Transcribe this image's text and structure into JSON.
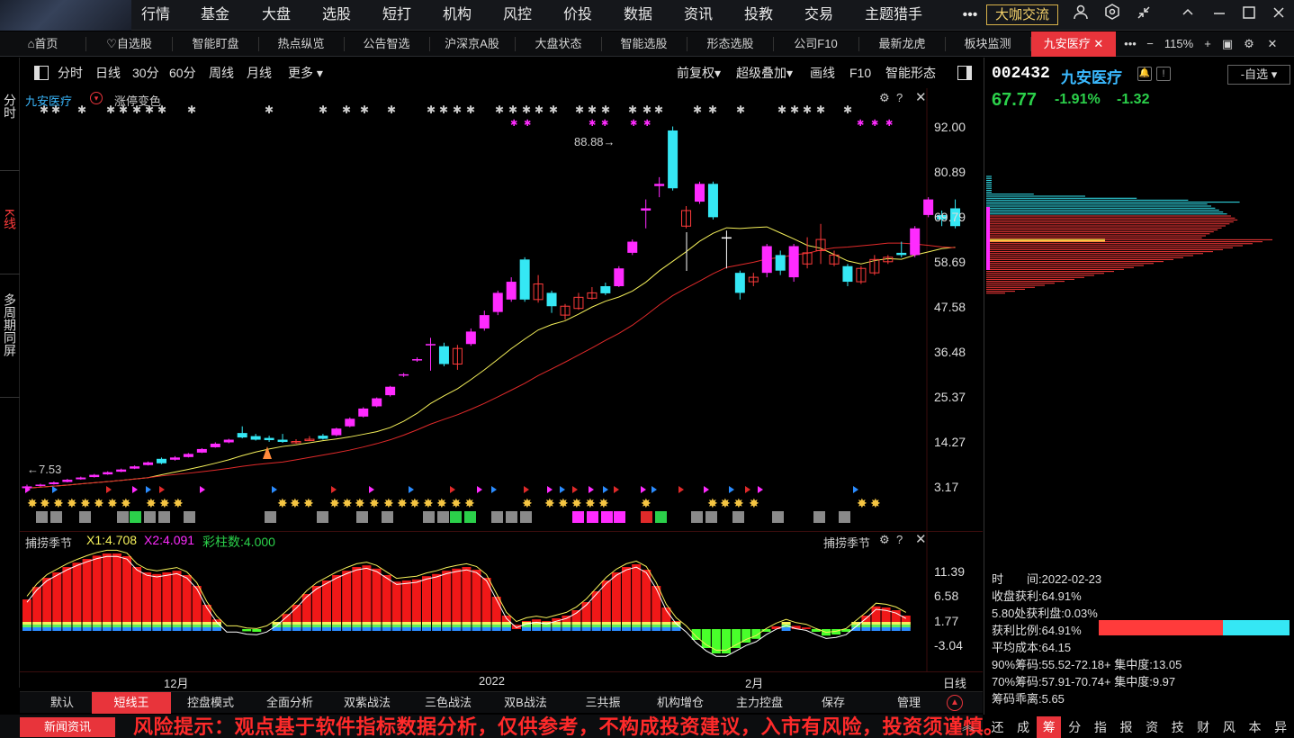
{
  "top_menu": {
    "items": [
      "行情",
      "基金",
      "大盘",
      "选股",
      "短打",
      "机构",
      "风控",
      "价投",
      "数据",
      "资讯",
      "投教",
      "交易",
      "主题猎手"
    ],
    "more": "•••",
    "cafe_button": "大咖交流"
  },
  "tab_bar": {
    "tabs": [
      "首页",
      "自选股",
      "智能盯盘",
      "热点纵览",
      "公告智选",
      "沪深京A股",
      "大盘状态",
      "智能选股",
      "形态选股",
      "公司F10",
      "最新龙虎",
      "板块监测",
      "九安医疗"
    ],
    "zoom": "115%"
  },
  "left_strip": {
    "labels": [
      "分时",
      "K线",
      "多周期同屏"
    ]
  },
  "period_bar": {
    "items": [
      "分时",
      "日线",
      "30分",
      "60分",
      "周线",
      "月线",
      "更多"
    ],
    "right_items": [
      "前复权",
      "超级叠加",
      "画线",
      "F10",
      "智能形态"
    ]
  },
  "main_chart": {
    "stock_label": "九安医疗",
    "indicator_label": "涨停变色",
    "high_annotation": "88.88",
    "low_annotation": "7.53",
    "price_ticks": [
      "92.00",
      "80.89",
      "69.79",
      "58.69",
      "47.58",
      "36.48",
      "25.37",
      "14.27",
      "3.17"
    ]
  },
  "sub_chart": {
    "name": "捕捞季节",
    "x1": "X1:4.708",
    "x2": "X2:4.091",
    "bars": "彩柱数:4.000",
    "ticks": [
      "11.39",
      "6.58",
      "1.77",
      "-3.04"
    ],
    "title_right": "捕捞季节"
  },
  "time_axis": {
    "labels": [
      "12月",
      "2022",
      "2月"
    ],
    "period": "日线"
  },
  "strategy_bar": {
    "items": [
      "默认",
      "短线王",
      "控盘模式",
      "全面分析",
      "双紫战法",
      "三色战法",
      "双B战法",
      "三共振",
      "机构增仓",
      "主力控盘",
      "保存",
      "管理"
    ]
  },
  "right_panel": {
    "code": "002432",
    "name": "九安医疗",
    "self_button": "-自选",
    "price": "67.77",
    "pct": "-1.91%",
    "change": "-1.32",
    "stats": [
      "时　　间:2022-02-23",
      "收盘获利:64.91%",
      "5.80处获利盘:0.03%",
      "获利比例:64.91%",
      "平均成本:64.15",
      "90%筹码:55.52-72.18+ 集中度:13.05",
      "70%筹码:57.91-70.74+ 集中度:9.97",
      "筹码乖离:5.65"
    ],
    "profit_ratio": 0.6491
  },
  "bottom": {
    "news_button": "新闻资讯",
    "risk_warning": "风险提示：观点基于软件指标数据分析，仅供参考，不构成投资建议，入市有风险，投资须谨慎。",
    "right_tabs": [
      "还",
      "成",
      "筹",
      "分",
      "指",
      "报",
      "资",
      "技",
      "财",
      "风",
      "本",
      "异"
    ]
  },
  "colors": {
    "up": "#ff3b3b",
    "down": "#2bd04a",
    "accent": "#e8343b",
    "cyan": "#35e7f4",
    "magenta": "#ff2bff"
  }
}
